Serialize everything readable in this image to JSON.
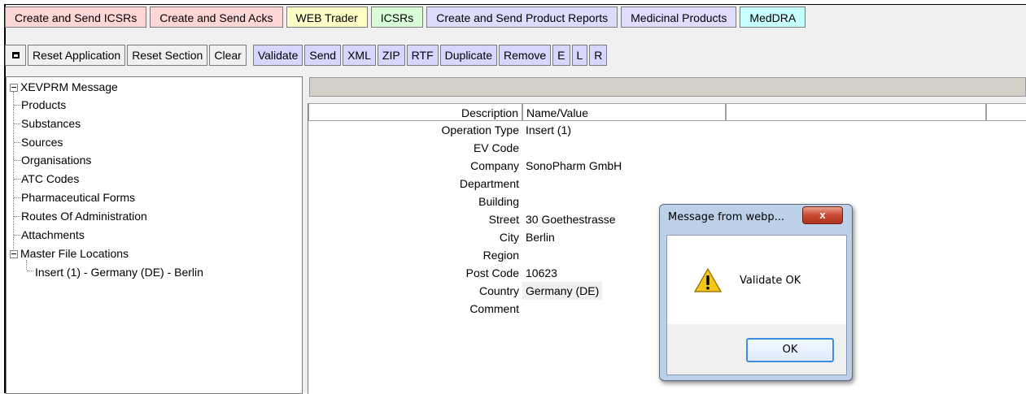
{
  "tabs": [
    {
      "label": "Create and Send ICSRs"
    },
    {
      "label": "Create and Send Acks"
    },
    {
      "label": "WEB Trader"
    },
    {
      "label": "ICSRs"
    },
    {
      "label": "Create and Send Product Reports"
    },
    {
      "label": "Medicinal Products"
    },
    {
      "label": "MedDRA"
    }
  ],
  "toolbar": {
    "reset_application": "Reset Application",
    "reset_section": "Reset Section",
    "clear": "Clear",
    "validate": "Validate",
    "send": "Send",
    "xml": "XML",
    "zip": "ZIP",
    "rtf": "RTF",
    "duplicate": "Duplicate",
    "remove": "Remove",
    "e": "E",
    "l": "L",
    "r": "R"
  },
  "tree": {
    "root": "XEVPRM Message",
    "items": [
      "Products",
      "Substances",
      "Sources",
      "Organisations",
      "ATC Codes",
      "Pharmaceutical Forms",
      "Routes Of Administration",
      "Attachments",
      "Master File Locations"
    ],
    "child": "Insert (1) - Germany (DE) - Berlin"
  },
  "detail": {
    "headers": {
      "description": "Description",
      "name_value": "Name/Value"
    },
    "rows": [
      {
        "label": "Operation Type",
        "value": "Insert (1)"
      },
      {
        "label": "EV Code",
        "value": ""
      },
      {
        "label": "Company",
        "value": "SonoPharm GmbH"
      },
      {
        "label": "Department",
        "value": ""
      },
      {
        "label": "Building",
        "value": ""
      },
      {
        "label": "Street",
        "value": "30 Goethestrasse"
      },
      {
        "label": "City",
        "value": "Berlin"
      },
      {
        "label": "Region",
        "value": ""
      },
      {
        "label": "Post Code",
        "value": "10623"
      },
      {
        "label": "Country",
        "value": "Germany (DE)"
      },
      {
        "label": "Comment",
        "value": ""
      }
    ]
  },
  "dialog": {
    "title": "Message from webp...",
    "close": "x",
    "message": "Validate OK",
    "ok": "OK"
  }
}
